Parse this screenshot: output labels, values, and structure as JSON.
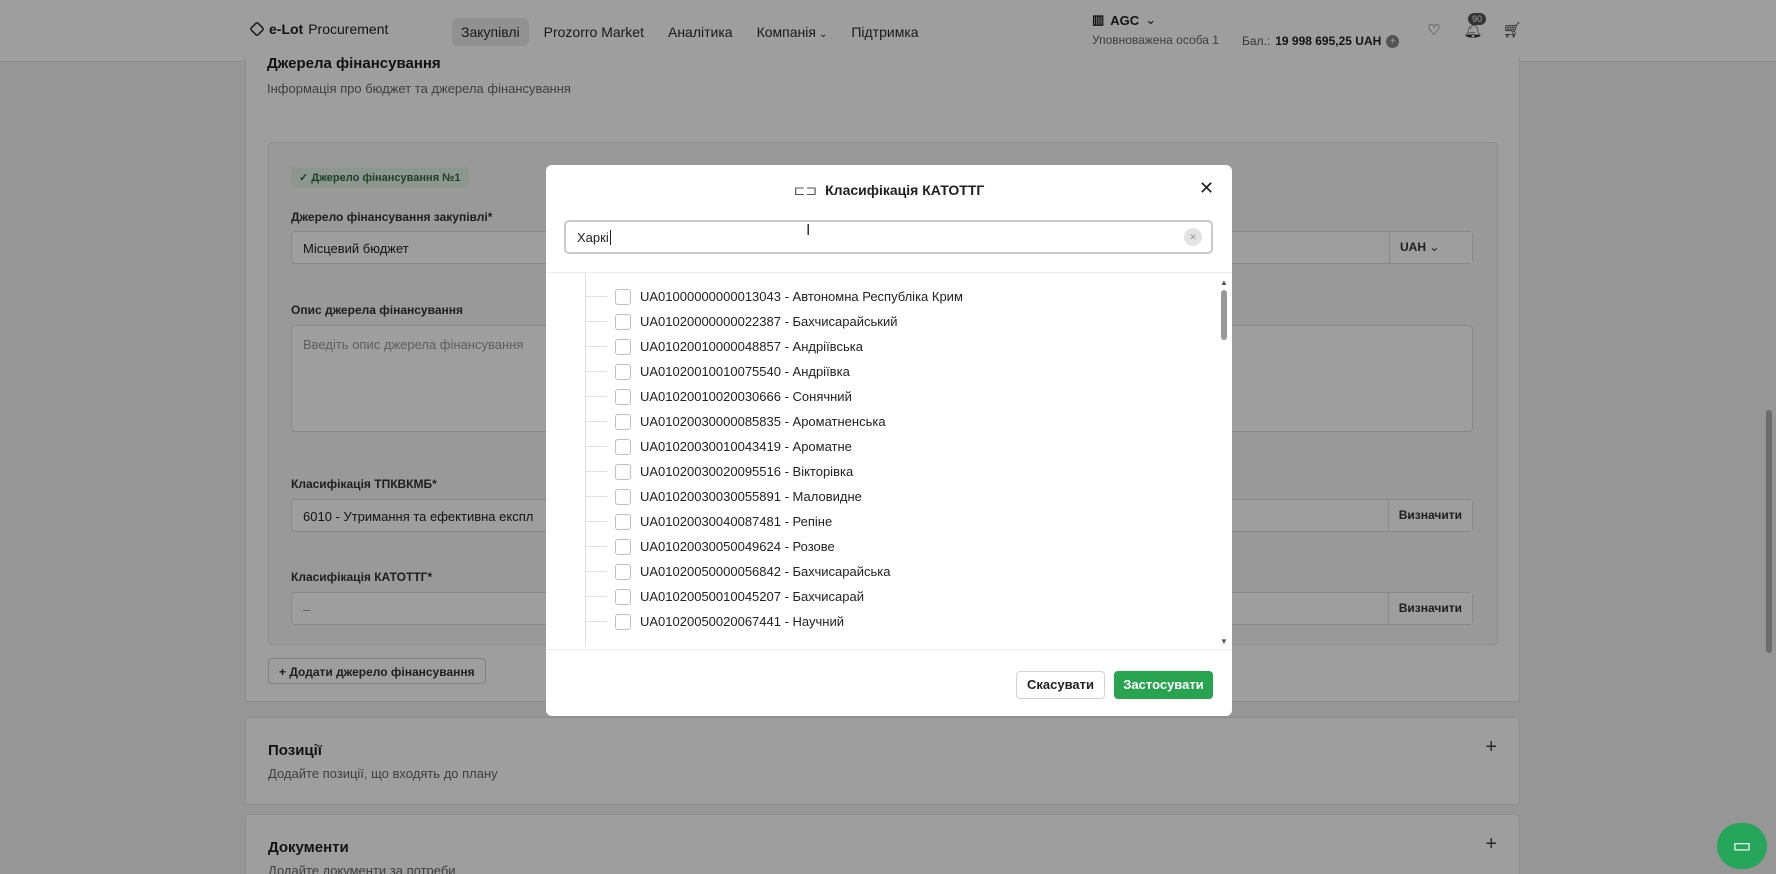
{
  "header": {
    "logo_bold": "e-Lot",
    "logo_rest": "Procurement",
    "nav": [
      "Закупівлі",
      "Prozorro Market",
      "Аналітика",
      "Компанія",
      "Підтримка"
    ],
    "org_name": "AGC",
    "org_sub": "Уповноважена особа 1",
    "balance_label": "Бал.:",
    "balance_value": "19 998 695,25 UAH",
    "notifications": "90"
  },
  "funding": {
    "title": "Джерела фінансування",
    "subtitle": "Інформація про бюджет та джерела фінансування",
    "badge": "Джерело фінансування №1",
    "source_label": "Джерело фінансування закупівлі*",
    "source_value": "Місцевий бюджет",
    "currency": "UAH",
    "desc_label": "Опис джерела фінансування",
    "desc_placeholder": "Введіть опис джерела фінансування",
    "tpkvkmb_label": "Класифікація ТПКВКМБ*",
    "tpkvkmb_value": "6010 - Утримання та ефективна експл",
    "katottg_label": "Класифікація КАТОТТГ*",
    "katottg_value": "–",
    "define_btn": "Визначити",
    "add_btn": "Додати джерело фінансування"
  },
  "positions": {
    "title": "Позиції",
    "subtitle": "Додайте позиції, що входять до плану"
  },
  "documents": {
    "title": "Документи",
    "subtitle": "Додайте документи за потреби"
  },
  "modal": {
    "title": "Класифікація КАТОТТГ",
    "search_value": "Харкі",
    "items": [
      "UA01000000000013043 - Автономна Республіка Крим",
      "UA01020000000022387 - Бахчисарайський",
      "UA01020010000048857 - Андріївська",
      "UA01020010010075540 - Андріївка",
      "UA01020010020030666 - Сонячний",
      "UA01020030000085835 - Ароматненська",
      "UA01020030010043419 - Ароматне",
      "UA01020030020095516 - Вікторівка",
      "UA01020030030055891 - Маловидне",
      "UA01020030040087481 - Репіне",
      "UA01020030050049624 - Розове",
      "UA01020050000056842 - Бахчисарайська",
      "UA01020050010045207 - Бахчисарай",
      "UA01020050020067441 - Научний"
    ],
    "cancel": "Скасувати",
    "apply": "Застосувати"
  }
}
